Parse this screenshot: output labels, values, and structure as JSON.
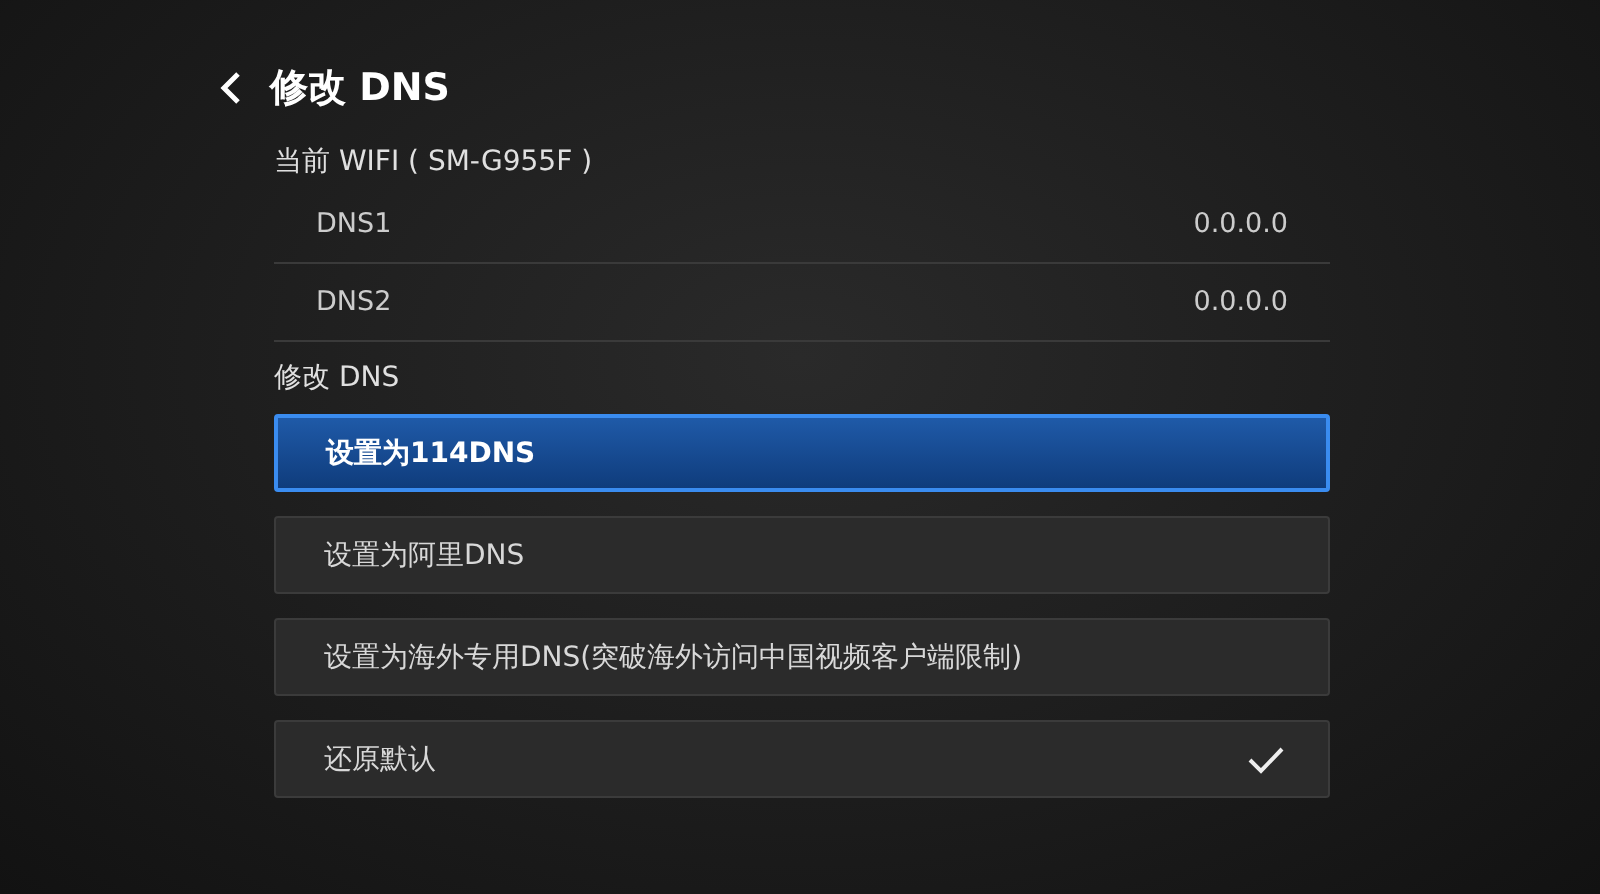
{
  "header": {
    "title": "修改 DNS"
  },
  "current": {
    "label": "当前 WIFI ( SM-G955F )",
    "rows": [
      {
        "name": "DNS1",
        "value": "0.0.0.0"
      },
      {
        "name": "DNS2",
        "value": "0.0.0.0"
      }
    ]
  },
  "modify": {
    "label": "修改 DNS",
    "options": [
      {
        "label": "设置为114DNS",
        "selected": true,
        "checked": false
      },
      {
        "label": "设置为阿里DNS",
        "selected": false,
        "checked": false
      },
      {
        "label": "设置为海外专用DNS(突破海外访问中国视频客户端限制)",
        "selected": false,
        "checked": false
      },
      {
        "label": "还原默认",
        "selected": false,
        "checked": true
      }
    ]
  }
}
